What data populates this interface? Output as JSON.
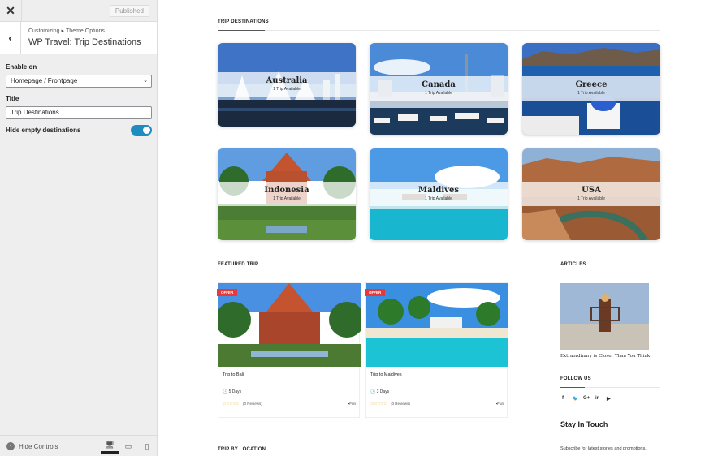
{
  "sidebar": {
    "close_icon": "close-icon",
    "publish_label": "Published",
    "breadcrumb_root": "Customizing",
    "breadcrumb_parent": "Theme Options",
    "panel_title": "WP Travel: Trip Destinations",
    "enable_on_label": "Enable on",
    "enable_on_value": "Homepage / Frontpage",
    "title_label": "Title",
    "title_value": "Trip Destinations",
    "hide_empty_label": "Hide empty destinations",
    "hide_empty_enabled": true,
    "hide_controls_label": "Hide Controls",
    "accent_color": "#1e8cbe"
  },
  "preview": {
    "destinations_heading": "TRIP DESTINATIONS",
    "destinations": [
      {
        "name": "Australia",
        "count": "1 Trip Available"
      },
      {
        "name": "Canada",
        "count": "1 Trip Available"
      },
      {
        "name": "Greece",
        "count": "1 Trip Available"
      },
      {
        "name": "Indonesia",
        "count": "1 Trip Available"
      },
      {
        "name": "Maldives",
        "count": "1 Trip Available"
      },
      {
        "name": "USA",
        "count": "1 Trip Available"
      }
    ],
    "featured_heading": "FEATURED TRIP",
    "featured": [
      {
        "badge": "OFFER",
        "name": "Trip to Bali",
        "days": "5 Days",
        "stars": "☆☆☆☆☆",
        "reviews": "(0 Reviews)",
        "tag": "Fun"
      },
      {
        "badge": "OFFER",
        "name": "Trip to Maldives",
        "days": "3 Days",
        "stars": "☆☆☆☆☆",
        "reviews": "(0 Reviews)",
        "tag": "Fun"
      }
    ],
    "articles_heading": "ARTICLES",
    "article_title": "Extraordinary is Closer Than You Think",
    "follow_heading": "FOLLOW US",
    "social": [
      "f",
      "🐦",
      "G+",
      "in",
      "▶"
    ],
    "stay_title": "Stay In Touch",
    "subscribe_text": "Subscribe for latest stories and promotions.",
    "location_heading": "TRIP BY LOCATION",
    "offer_color": "#e33b3b"
  }
}
